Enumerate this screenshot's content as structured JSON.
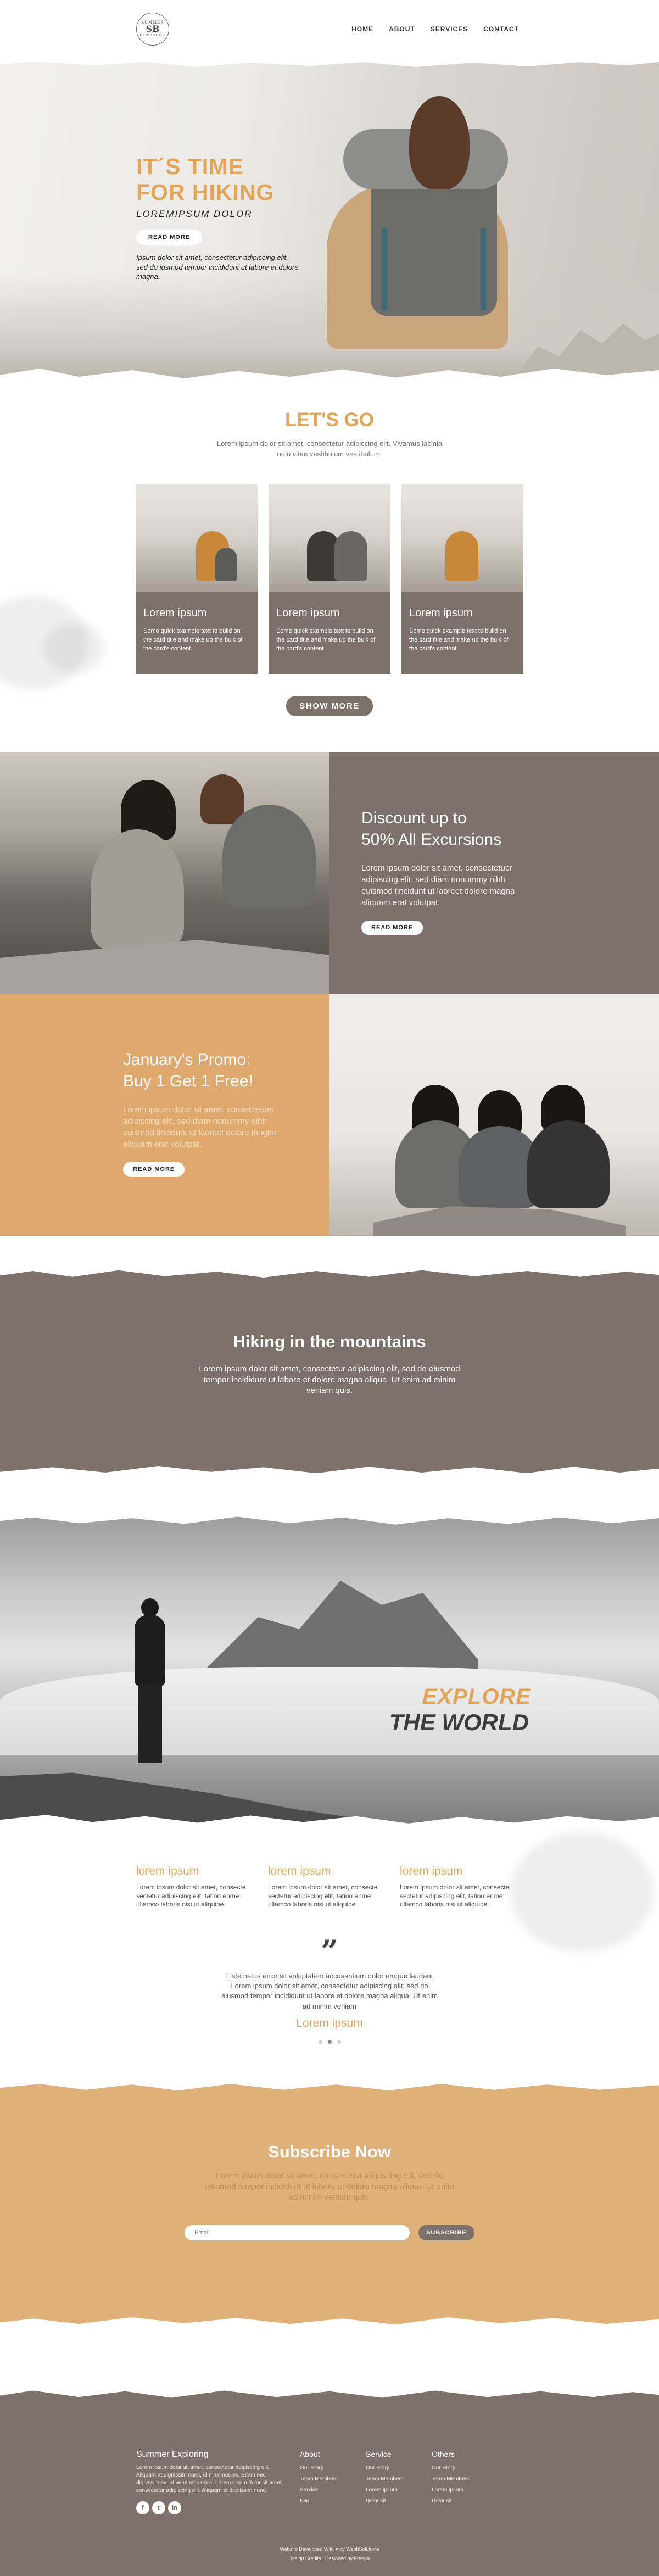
{
  "logo": {
    "top": "SUMMER",
    "center": "SB",
    "bottom": "EXPLORING"
  },
  "nav": [
    "HOME",
    "ABOUT",
    "SERVICES",
    "CONTACT"
  ],
  "hero": {
    "title_line1": "IT´S TIME",
    "title_line2": "FOR HIKING",
    "subtitle": "LOREMIPSUM DOLOR",
    "button": "READ MORE",
    "description": "Ipsum dolor sit amet, consectetur adipiscing elit, sed do iusmod tempor incididunt ut labore et dolore magna."
  },
  "letsgo": {
    "title": "LET'S GO",
    "description": "Lorem ipsum dolor sit amet, consectetur adipiscing elit. Vivamus lacinia odio vitae vestibulum vestibulum.",
    "cards": [
      {
        "title": "Lorem ipsum",
        "text": "Some quick example text to build on the card title and make up the bulk of the card's content."
      },
      {
        "title": "Lorem ipsum",
        "text": "Some quick example text to build on the card title and make up the bulk of the card's content."
      },
      {
        "title": "Lorem ipsum",
        "text": "Some quick example text to build on the card title and make up the bulk of the card's content."
      }
    ],
    "button": "SHOW MORE"
  },
  "discount": {
    "title_line1": "Discount up to",
    "title_line2": "50% All Excursions",
    "text": "Lorem ipsum dolor sit amet, consectetuer adipiscing elit, sed diam nonummy nibh euismod tincidunt ut laoreet dolore magna aliquam erat volutpat.",
    "button": "READ MORE"
  },
  "promo": {
    "title_line1": "January's Promo:",
    "title_line2": "Buy 1 Get 1 Free!",
    "text": "Lorem ipsum dolor sit amet, consectetuer adipiscing elit, sed diam nonummy nibh euismod tincidunt ut laoreet dolore magna aliquam erat volutpat.",
    "button": "READ MORE"
  },
  "hiking": {
    "title": "Hiking in the mountains",
    "text": "Lorem ipsum dolor sit amet, consectetur adipiscing elit, sed do eiusmod tempor incididunt ut labore et dolore magna aliqua. Ut enim ad minim veniam quis."
  },
  "explore": {
    "line1": "EXPLORE",
    "line2": "THE WORLD"
  },
  "features": [
    {
      "title": "lorem ipsum",
      "text": "Lorem ipsum dolor sit amet, consecte sectetur adipiscing elit, tation enme ullamco laboris nisi ut aliquipe."
    },
    {
      "title": "lorem ipsum",
      "text": "Lorem ipsum dolor sit amet, consecte sectetur adipiscing elit, tation enme ullamco laboris nisi ut aliquipe."
    },
    {
      "title": "lorem ipsum",
      "text": "Lorem ipsum dolor sit amet, consecte sectetur adipiscing elit, tation enme ullamco laboris nisi ut aliquipe."
    }
  ],
  "testimonial": {
    "quote_mark": "”",
    "text": "Liste natus error sit voluptatem accusantium dolor emque laudant Lorem ipsum dolor sit amet, consectetur adipiscing elit, sed do eiusmod tempor incididunt ut labore et dolore magna aliqua. Ut enim ad minim veniam",
    "name": "Lorem ipsum"
  },
  "subscribe": {
    "title": "Subscribe Now",
    "text": "Lorem ipsum dolor sit amet, consectetur adipiscing elit, sed do eiusmod tempor incididunt ut labore et dolore magna aliqua. Ut enim ad minim veniam quis.",
    "placeholder": "Email",
    "button": "SUBSCRIBE"
  },
  "footer": {
    "brand": "Summer Exploring",
    "brand_text": "Lorem ipsum dolor sit amet, consectetur adipiscing elit. Aliquam at dignissim nunc, id maximus ex. Etiam nec dignissim ex, ut venenatis risus. Lorem ipsum dolor sit amet, consectetur adipiscing elit. Aliquam at dignissim nunc.",
    "socials": [
      "f",
      "t",
      "in"
    ],
    "columns": [
      {
        "title": "About",
        "items": [
          "Our Story",
          "Team Members",
          "Service",
          "Faq"
        ]
      },
      {
        "title": "Service",
        "items": [
          "Our Story",
          "Team Members",
          "Lorem ipsum",
          "Dolor sit"
        ]
      },
      {
        "title": "Others",
        "items": [
          "Our Story",
          "Team Members",
          "Lorem ipsum",
          "Dolor sit"
        ]
      }
    ],
    "credit_line1": "Website Developed With ♥ by WebhSolutions",
    "credit_line2": "Design Credits : Designed by Freepik"
  },
  "colors": {
    "accent": "#e3a456",
    "brand_grey": "#7d726b",
    "sand": "#dfb078"
  }
}
